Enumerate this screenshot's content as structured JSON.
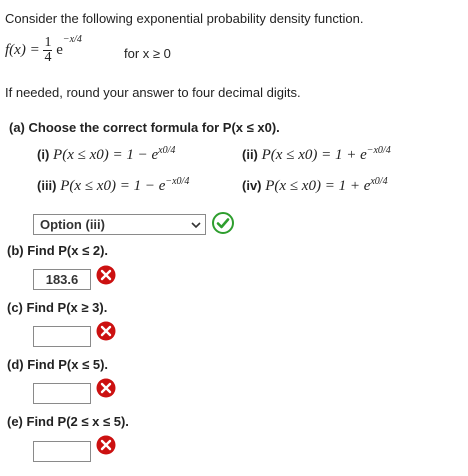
{
  "intro": "Consider the following exponential probability density function.",
  "pdf": {
    "lhs": "f(x) =",
    "numerator": "1",
    "denominator": "4",
    "exp_base": "e",
    "exp_power": "−x/4",
    "domain": "for x ≥ 0"
  },
  "rounding": "If needed, round your answer to four decimal digits.",
  "part_a": {
    "prompt": "(a) Choose the correct formula for P(x ≤ x0).",
    "options": [
      {
        "label": "(i)",
        "lhs": "P(x ≤ x0) = 1 − e",
        "exp": "x0/4"
      },
      {
        "label": "(ii)",
        "lhs": "P(x ≤ x0) = 1 + e",
        "exp": "−x0/4"
      },
      {
        "label": "(iii)",
        "lhs": "P(x ≤ x0) = 1 − e",
        "exp": "−x0/4"
      },
      {
        "label": "(iv)",
        "lhs": "P(x ≤ x0) = 1 + e",
        "exp": "x0/4"
      }
    ],
    "selected": "Option (iii)",
    "status": "correct",
    "check_color": "#2e9e2e"
  },
  "part_b": {
    "prompt": "(b) Find P(x ≤ 2).",
    "value": "183.6",
    "status": "incorrect"
  },
  "part_c": {
    "prompt": "(c) Find P(x ≥ 3).",
    "value": "",
    "status": "incorrect"
  },
  "part_d": {
    "prompt": "(d) Find P(x ≤ 5).",
    "value": "",
    "status": "incorrect"
  },
  "part_e": {
    "prompt": "(e) Find P(2 ≤ x ≤ 5).",
    "value": "",
    "status": "incorrect"
  },
  "colors": {
    "incorrect": "#cc1111",
    "correct": "#2e9e2e"
  }
}
